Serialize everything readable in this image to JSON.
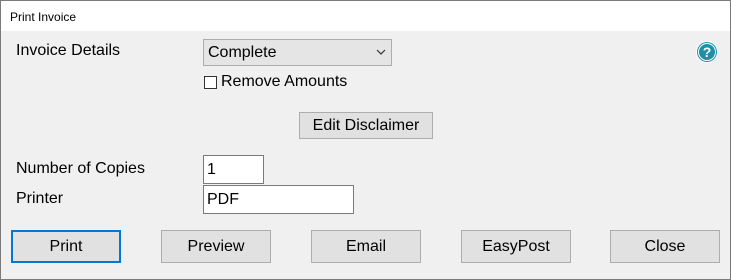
{
  "window": {
    "title": "Print Invoice"
  },
  "form": {
    "invoice_details_label": "Invoice Details",
    "invoice_details_value": "Complete",
    "remove_amounts_label": "Remove Amounts",
    "edit_disclaimer_label": "Edit Disclaimer",
    "copies_label": "Number of Copies",
    "copies_value": "1",
    "printer_label": "Printer",
    "printer_value": "PDF"
  },
  "help": {
    "glyph": "?",
    "color": "#1f8fa8"
  },
  "buttons": {
    "print": "Print",
    "preview": "Preview",
    "email": "Email",
    "easypost": "EasyPost",
    "close": "Close"
  }
}
